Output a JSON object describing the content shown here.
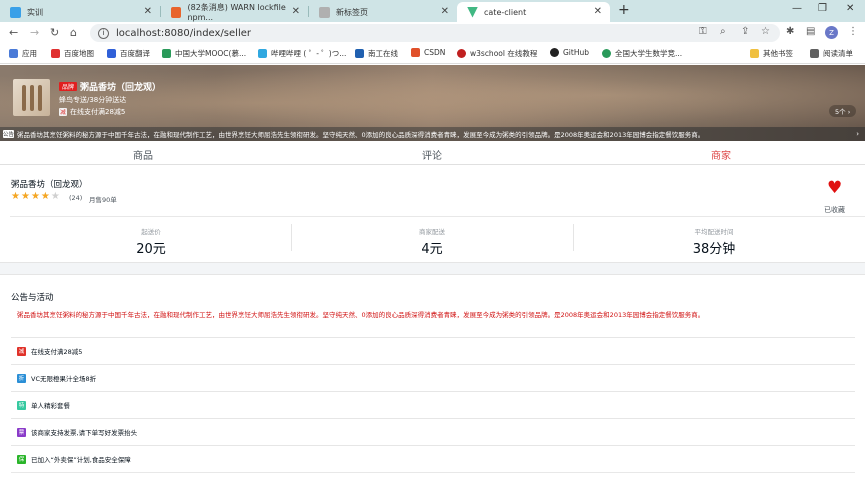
{
  "browser": {
    "tabs": [
      {
        "title": "实训",
        "color": "#3aa0e8"
      },
      {
        "title": "(82条消息) WARN lockfile npm...",
        "color": "#e8642c"
      },
      {
        "title": "新标签页",
        "color": "#b0b0b0"
      },
      {
        "title": "cate-client",
        "color": "#41b883"
      }
    ],
    "url": "localhost:8080/index/seller",
    "avatar_letter": "Z",
    "bookmarks": [
      {
        "label": "应用",
        "color": "#4a7bd8"
      },
      {
        "label": "百度地图",
        "color": "#e03030"
      },
      {
        "label": "百度翻译",
        "color": "#3060d8"
      },
      {
        "label": "中国大学MOOC(慕...",
        "color": "#2a9a5a"
      },
      {
        "label": "哔哩哔哩 ( ゜- ゜)つ...",
        "color": "#30a8e0"
      },
      {
        "label": "南工在线",
        "color": "#2060b0"
      },
      {
        "label": "CSDN",
        "color": "#e0502a"
      },
      {
        "label": "w3school 在线教程",
        "color": "#c02020"
      },
      {
        "label": "GitHub",
        "color": "#222222"
      },
      {
        "label": "全国大学生数学竞...",
        "color": "#2a9a5a"
      },
      {
        "label": "其他书签",
        "color": "#f0c040"
      },
      {
        "label": "阅读清单",
        "color": "#606060"
      }
    ]
  },
  "header": {
    "brand_badge": "品牌",
    "shop_name": "粥品香坊（回龙观）",
    "delivery": "蜂鸟专送/38分钟送达",
    "support_icon": "减",
    "support_text": "在线支付满28减5",
    "support_count": "5个 ›",
    "bulletin_badge": "公告",
    "bulletin": "粥品香坊其烹饪粥料的秘方源于中国千年古法，在融和现代制作工艺，由世界烹饪大师屈浩先生领衔研发。坚守纯天然、0添加的良心品质深得消费者青睐，发展至今成为粥类的引领品牌。是2008年奥运会和2013年园博会指定餐饮服务商。",
    "bulletin_arrow": "›"
  },
  "nav": {
    "goods": "商品",
    "ratings": "评论",
    "seller": "商家"
  },
  "overview": {
    "name": "粥品香坊（回龙观）",
    "score": 4,
    "ratings_count": "(24)",
    "sell_count": "月售90单",
    "favorite_label": "已收藏",
    "stats": [
      {
        "label": "起送价",
        "value": "20元"
      },
      {
        "label": "商家配送",
        "value": "4元"
      },
      {
        "label": "平均配送时间",
        "value": "38分钟"
      }
    ]
  },
  "bulletin_section": {
    "title": "公告与活动",
    "content": "粥品香坊其烹饪粥料的秘方源于中国千年古法，在融和现代制作工艺，由世界烹饪大师屈浩先生领衔研发。坚守纯天然、0添加的良心品质深得消费者青睐，发展至今成为粥类的引领品牌。是2008年奥运会和2013年园博会指定餐饮服务商。",
    "supports": [
      {
        "icon": "减",
        "text": "在线支付满28减5",
        "color": "#e0322a"
      },
      {
        "icon": "折",
        "text": "VC无限橙果汁全场8折",
        "color": "#2b8fd6"
      },
      {
        "icon": "特",
        "text": "单人精彩套餐",
        "color": "#36c9a0"
      },
      {
        "icon": "票",
        "text": "该商家支持发票,请下单写好发票抬头",
        "color": "#8a3bc9"
      },
      {
        "icon": "保",
        "text": "已加入“外卖保”计划,食品安全保障",
        "color": "#2ab52a"
      }
    ]
  }
}
